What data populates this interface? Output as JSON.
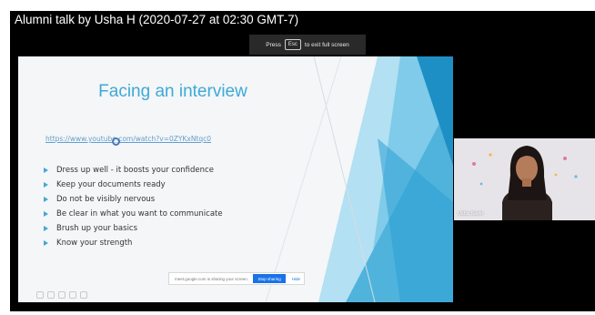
{
  "video": {
    "title": "Alumni talk by Usha H (2020-07-27 at 02:30 GMT-7)",
    "esc_hint": {
      "before": "Press",
      "key": "Esc",
      "after": "to exit full screen"
    }
  },
  "slide": {
    "title": "Facing an interview",
    "link": "https://www.youtube.com/watch?v=0ZYKxNtqc0",
    "bullets": [
      "Dress up well - it boosts your confidence",
      "Keep your documents ready",
      "Do not be visibly nervous",
      "Be clear in what you want to communicate",
      "Brush up your basics",
      "Know your strength"
    ],
    "share_bar": {
      "text": "meet.google.com is sharing your screen.",
      "stop_label": "Stop sharing",
      "hide_label": "Hide"
    }
  },
  "participant": {
    "name": "Usha Savin"
  },
  "colors": {
    "title": "#3fa9d5",
    "accent": "#3fa9d5",
    "stop_button": "#1a73e8"
  }
}
